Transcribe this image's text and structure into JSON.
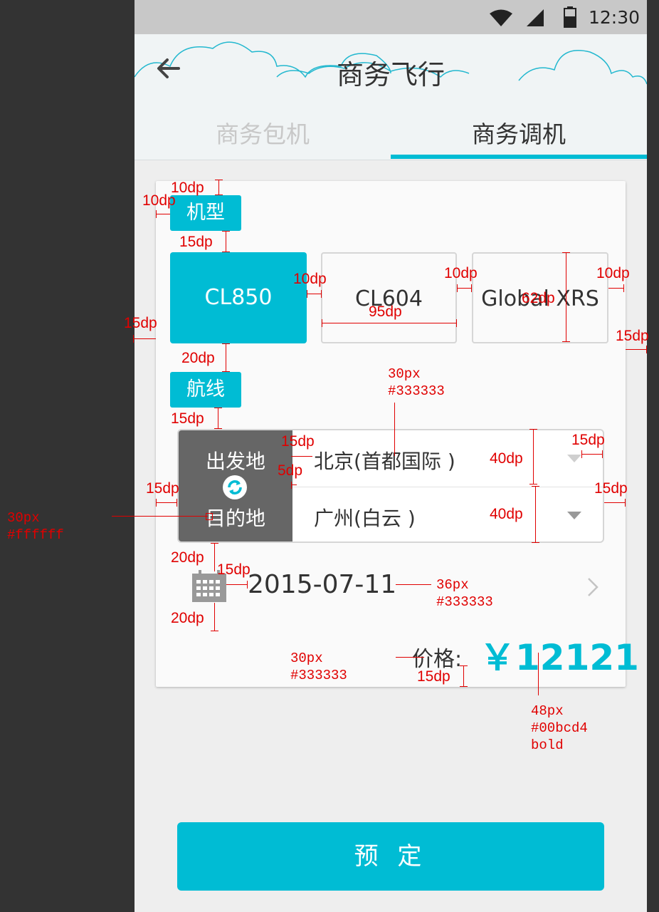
{
  "status_bar": {
    "time": "12:30",
    "icons": [
      "wifi-icon",
      "signal-icon",
      "battery-icon"
    ]
  },
  "header": {
    "title": "商务飞行",
    "back_icon": "arrow-left-icon"
  },
  "tabs": [
    {
      "label": "商务包机",
      "active": false
    },
    {
      "label": "商务调机",
      "active": true
    }
  ],
  "aircraft": {
    "tag": "机型",
    "options": [
      {
        "label": "CL850",
        "selected": true
      },
      {
        "label": "CL604",
        "selected": false
      },
      {
        "label": "Global XRS",
        "selected": false
      }
    ]
  },
  "route": {
    "tag": "航线",
    "from_label": "出发地",
    "to_label": "目的地",
    "from_value": "北京(首都国际 )",
    "to_value": "广州(白云 )",
    "swap_icon": "swap-icon"
  },
  "date": {
    "value": "2015-07-11",
    "icon": "calendar-icon",
    "chevron": "chevron-right-icon"
  },
  "price": {
    "label": "价格:",
    "value": "￥12121"
  },
  "book_button": "预 定",
  "colors": {
    "accent": "#00bcd4",
    "text": "#333333",
    "route_panel": "#666666",
    "annotation": "#e00000"
  },
  "annotations": {
    "dp10": "10dp",
    "dp15": "15dp",
    "dp20": "20dp",
    "dp5": "5dp",
    "dp40": "40dp",
    "dp95": "95dp",
    "dp62": "62dp",
    "spec_route_from": "30px\n#333333",
    "spec_route_label": "30px\n#ffffff",
    "spec_date": "36px\n#333333",
    "spec_price_label": "30px\n#333333",
    "spec_price": "48px\n#00bcd4\nbold"
  }
}
